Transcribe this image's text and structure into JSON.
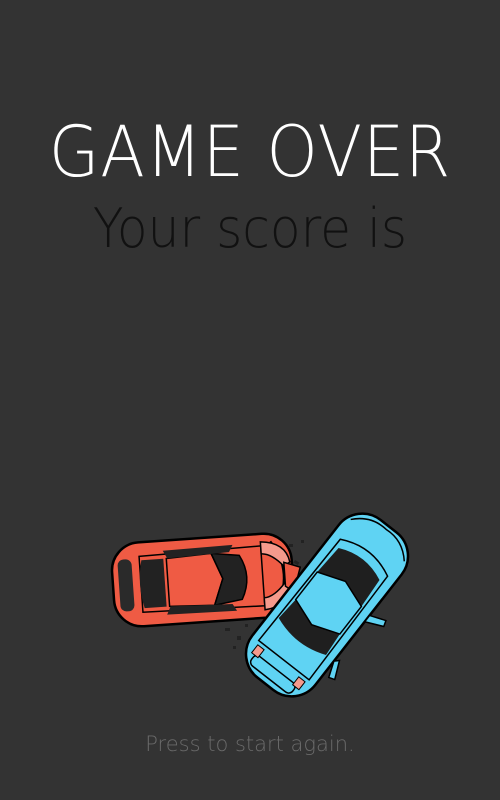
{
  "screen": {
    "title": "GAME OVER",
    "subtitle": "Your score is",
    "restart_prompt": "Press to start again."
  },
  "illustration": {
    "icon": "car-crash-icon",
    "cars": [
      {
        "name": "red-car",
        "color": "#ef5b44"
      },
      {
        "name": "blue-car",
        "color": "#5fd3f3"
      }
    ]
  },
  "colors": {
    "background": "#333333",
    "title": "#ffffff",
    "subtitle": "#111111",
    "prompt": "#6a6a6a"
  }
}
